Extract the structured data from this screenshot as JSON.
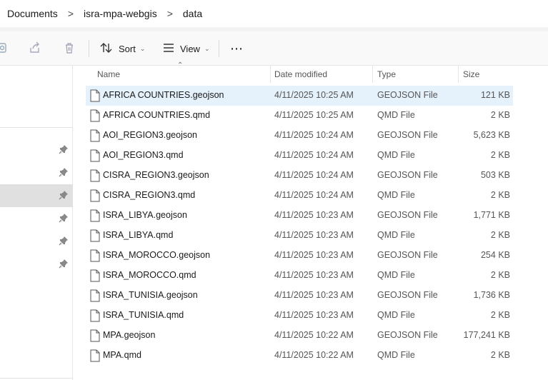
{
  "breadcrumb": {
    "items": [
      "Documents",
      "isra-mpa-webgis",
      "data"
    ],
    "separator": ">"
  },
  "toolbar": {
    "sort_label": "Sort",
    "view_label": "View",
    "more_label": "⋯"
  },
  "columns": {
    "name": "Name",
    "date": "Date modified",
    "type": "Type",
    "size": "Size"
  },
  "files": [
    {
      "name": "AFRICA COUNTRIES.geojson",
      "date": "4/11/2025 10:25 AM",
      "type": "GEOJSON File",
      "size": "121 KB"
    },
    {
      "name": "AFRICA COUNTRIES.qmd",
      "date": "4/11/2025 10:25 AM",
      "type": "QMD File",
      "size": "2 KB"
    },
    {
      "name": "AOI_REGION3.geojson",
      "date": "4/11/2025 10:24 AM",
      "type": "GEOJSON File",
      "size": "5,623 KB"
    },
    {
      "name": "AOI_REGION3.qmd",
      "date": "4/11/2025 10:24 AM",
      "type": "QMD File",
      "size": "2 KB"
    },
    {
      "name": "CISRA_REGION3.geojson",
      "date": "4/11/2025 10:24 AM",
      "type": "GEOJSON File",
      "size": "503 KB"
    },
    {
      "name": "CISRA_REGION3.qmd",
      "date": "4/11/2025 10:24 AM",
      "type": "QMD File",
      "size": "2 KB"
    },
    {
      "name": "ISRA_LIBYA.geojson",
      "date": "4/11/2025 10:23 AM",
      "type": "GEOJSON File",
      "size": "1,771 KB"
    },
    {
      "name": "ISRA_LIBYA.qmd",
      "date": "4/11/2025 10:23 AM",
      "type": "QMD File",
      "size": "2 KB"
    },
    {
      "name": "ISRA_MOROCCO.geojson",
      "date": "4/11/2025 10:23 AM",
      "type": "GEOJSON File",
      "size": "254 KB"
    },
    {
      "name": "ISRA_MOROCCO.qmd",
      "date": "4/11/2025 10:23 AM",
      "type": "QMD File",
      "size": "2 KB"
    },
    {
      "name": "ISRA_TUNISIA.geojson",
      "date": "4/11/2025 10:23 AM",
      "type": "GEOJSON File",
      "size": "1,736 KB"
    },
    {
      "name": "ISRA_TUNISIA.qmd",
      "date": "4/11/2025 10:23 AM",
      "type": "QMD File",
      "size": "2 KB"
    },
    {
      "name": "MPA.geojson",
      "date": "4/11/2025 10:22 AM",
      "type": "GEOJSON File",
      "size": "177,241 KB"
    },
    {
      "name": "MPA.qmd",
      "date": "4/11/2025 10:22 AM",
      "type": "QMD File",
      "size": "2 KB"
    }
  ],
  "selected_file": "AFRICA COUNTRIES.geojson",
  "colors": {
    "selection": "#e5f1fb",
    "sidebar_selection": "#e0e0e0",
    "toolbar_bg": "#f9f9f9"
  },
  "icons": {
    "toolbar": [
      "share-partial-icon",
      "share-icon",
      "delete-icon",
      "sort-icon",
      "view-icon",
      "more-icon"
    ],
    "sidebar": [
      "pin-icon"
    ],
    "file": "document-icon"
  }
}
